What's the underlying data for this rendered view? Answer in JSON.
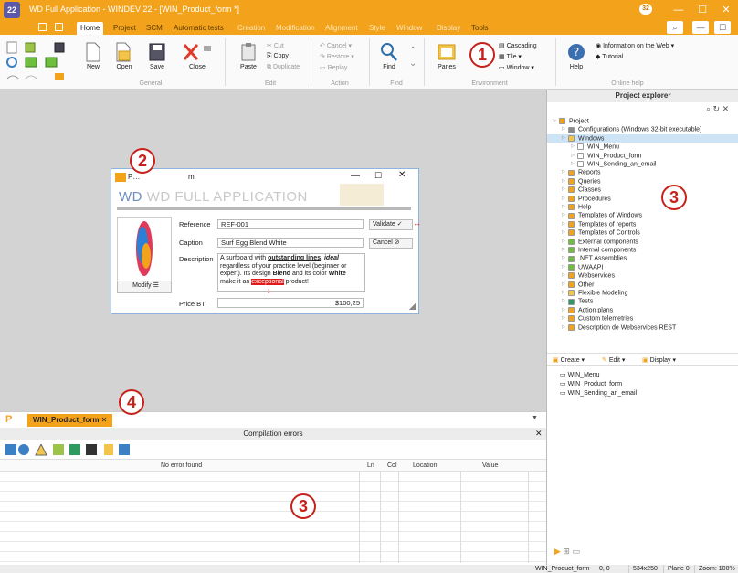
{
  "title_bar": {
    "title": "WD Full Application - WINDEV 22 - [WIN_Product_form *]",
    "logo": "22",
    "badge": "32",
    "controls": [
      "—",
      "☐",
      "✕"
    ]
  },
  "menu": {
    "tabs": [
      "Home",
      "Project",
      "SCM",
      "Automatic tests",
      "Creation",
      "Modification",
      "Alignment",
      "Style",
      "Window",
      "Display",
      "Tools"
    ],
    "active": "Home"
  },
  "ribbon": {
    "groups": [
      "General",
      "Edit",
      "Action",
      "Find",
      "Environment",
      "Online help"
    ],
    "buttons": {
      "new": "New",
      "open": "Open",
      "save": "Save",
      "close": "Close",
      "paste": "Paste",
      "find": "Find",
      "panes": "Panes",
      "help": "Help"
    },
    "edit_items": [
      "Cut",
      "Copy",
      "Duplicate"
    ],
    "action_items": [
      "Cancel",
      "Restore",
      "Replay"
    ],
    "env_items": [
      "Cascading",
      "Tile",
      "Window"
    ],
    "help_items": [
      "Information on the Web",
      "Tutorial"
    ]
  },
  "dialog": {
    "title": "P…",
    "title_suffix": "m",
    "header": "WD FULL APPLICATION",
    "labels": {
      "reference": "Reference",
      "caption": "Caption",
      "description": "Description",
      "price": "Price BT"
    },
    "values": {
      "reference": "REF-001",
      "caption": "Surf Egg Blend White",
      "price": "$100,25"
    },
    "description_parts": {
      "p1": "A surfboard with ",
      "b1": "outstanding lines",
      "p2": ", ",
      "bi1": "ideal",
      "p3": " regardless of your practice level (beginner or expert). Its design ",
      "b2": "Blend",
      "p4": " and its color ",
      "b3": "White",
      "p5": " make it an ",
      "hl": "exceptional",
      "p6": " product!"
    },
    "buttons": {
      "modify": "Modify",
      "validate": "Validate",
      "cancel": "Cancel"
    }
  },
  "project_explorer": {
    "title": "Project explorer",
    "items": [
      {
        "label": "Project",
        "level": 0
      },
      {
        "label": "Configurations (Windows 32-bit executable)",
        "level": 1
      },
      {
        "label": "Windows",
        "level": 1,
        "selected": true
      },
      {
        "label": "WIN_Menu",
        "level": 2
      },
      {
        "label": "WIN_Product_form",
        "level": 2
      },
      {
        "label": "WIN_Sending_an_email",
        "level": 2
      },
      {
        "label": "Reports",
        "level": 1
      },
      {
        "label": "Queries",
        "level": 1
      },
      {
        "label": "Classes",
        "level": 1
      },
      {
        "label": "Procedures",
        "level": 1
      },
      {
        "label": "Help",
        "level": 1
      },
      {
        "label": "Templates of Windows",
        "level": 1
      },
      {
        "label": "Templates of reports",
        "level": 1
      },
      {
        "label": "Templates of Controls",
        "level": 1
      },
      {
        "label": "External components",
        "level": 1
      },
      {
        "label": "Internal components",
        "level": 1
      },
      {
        "label": ".NET Assemblies",
        "level": 1
      },
      {
        "label": "UWAAPI",
        "level": 1
      },
      {
        "label": "Webservices",
        "level": 1
      },
      {
        "label": "Other",
        "level": 1
      },
      {
        "label": "Flexible Modeling",
        "level": 1
      },
      {
        "label": "Tests",
        "level": 1
      },
      {
        "label": "Action plans",
        "level": 1
      },
      {
        "label": "Custom telemetries",
        "level": 1
      },
      {
        "label": "Description de Webservices REST",
        "level": 1
      }
    ],
    "actions": [
      "Create",
      "Edit",
      "Display"
    ],
    "list_items": [
      "WIN_Menu",
      "WIN_Product_form",
      "WIN_Sending_an_email"
    ]
  },
  "bottom": {
    "tab": "WIN_Product_form",
    "pane_title": "Compilation errors",
    "columns": [
      "No error found",
      "Ln",
      "Col",
      "Location",
      "Value"
    ]
  },
  "status_bar": {
    "items": [
      "WIN_Product_form",
      "0, 0",
      "534x250",
      "Plane 0",
      "Zoom: 100%"
    ]
  },
  "callouts": [
    "1",
    "2",
    "3",
    "3",
    "4"
  ]
}
